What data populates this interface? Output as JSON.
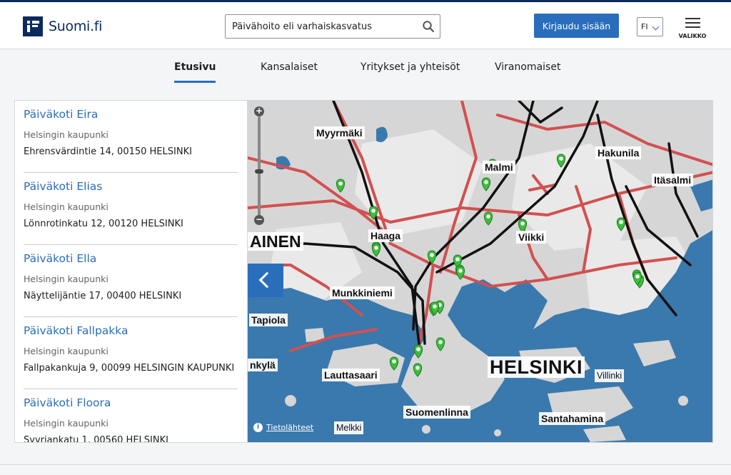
{
  "header": {
    "logo_text": "Suomi.fi",
    "search_value": "Päivähoito eli varhaiskasvatus",
    "login_label": "Kirjaudu sisään",
    "language": "FI",
    "menu_label": "VALIKKO"
  },
  "tabs": [
    {
      "label": "Etusivu",
      "active": true
    },
    {
      "label": "Kansalaiset",
      "active": false
    },
    {
      "label": "Yritykset ja yhteisöt",
      "active": false
    },
    {
      "label": "Viranomaiset",
      "active": false
    }
  ],
  "services": [
    {
      "name": "Päiväkoti Eira",
      "org": "Helsingin kaupunki",
      "address": "Ehrensvärdintie 14, 00150 HELSINKI"
    },
    {
      "name": "Päiväkoti Elias",
      "org": "Helsingin kaupunki",
      "address": "Lönnrotinkatu 12, 00120 HELSINKI"
    },
    {
      "name": "Päiväkoti Ella",
      "org": "Helsingin kaupunki",
      "address": "Näyttelijäntie 17, 00400 HELSINKI"
    },
    {
      "name": "Päiväkoti Fallpakka",
      "org": "Helsingin kaupunki",
      "address": "Fallpakankuja 9, 00099 HELSINGIN KAUPUNKI"
    },
    {
      "name": "Päiväkoti Floora",
      "org": "Helsingin kaupunki",
      "address": "Syvriankatu 1, 00560 HELSINKI"
    }
  ],
  "map": {
    "labels": {
      "myyrmaki": "Myyrmäki",
      "malmi": "Malmi",
      "hakunila": "Hakunila",
      "itasalmi": "Itäsalmi",
      "ainen": "AINEN",
      "haaga": "Haaga",
      "viikki": "Viikki",
      "munkkiniemi": "Munkkiniemi",
      "tapiola": "Tapiola",
      "nkyla": "nkylä",
      "lauttasaari": "Lauttasaari",
      "helsinki": "HELSINKI",
      "villinki": "Villinki",
      "suomenlinna": "Suomenlinna",
      "santahamina": "Santahamina",
      "melkki": "Melkki"
    },
    "attribution": "Tietolähteet",
    "zoom_in": "+",
    "zoom_out": "−",
    "marker_count": 24,
    "colors": {
      "sea": "#3a79ad",
      "land": "#d6d6d6",
      "road": "#d2504f",
      "rail": "#111111",
      "marker": "#3bbf3b"
    }
  }
}
